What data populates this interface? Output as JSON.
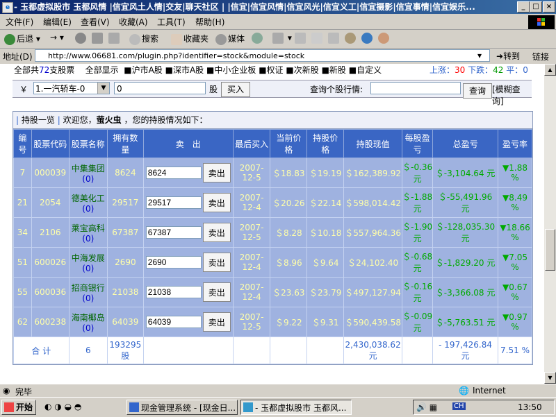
{
  "window": {
    "title": "- 玉都虚拟股市 玉都风情 |信宜风土人情|交友|聊天社区 | |信宜|信宜风情|信宜风光|信宜义工|信宜摄影|信宜事情|信宜娱乐...",
    "min": "_",
    "max": "□",
    "close": "×"
  },
  "menu": [
    "文件(F)",
    "编辑(E)",
    "查看(V)",
    "收藏(A)",
    "工具(T)",
    "帮助(H)"
  ],
  "toolbar": {
    "back": "后退",
    "forward": "→",
    "search": "搜索",
    "favorites": "收藏夹",
    "media": "媒体"
  },
  "address": {
    "label": "地址(D)",
    "url": "http://www.06681.com/plugin.php?identifier=stock&module=stock",
    "go": "转到",
    "links": "链接"
  },
  "summary": {
    "prefix": "全部共",
    "count": "72",
    "suffix": "支股票",
    "show_all": "全部显示",
    "filters": [
      "沪市A股",
      "深市A股",
      "中小企业板",
      "权证",
      "次新股",
      "新股",
      "自定义"
    ],
    "up_label": "上涨：",
    "up": "30",
    "down_label": "下跌：",
    "down": "42",
    "flat_label": "平：",
    "flat": "0"
  },
  "trade": {
    "currency_symbol": "￥",
    "selected_stock": "1.一汽轿车-0",
    "qty": "0",
    "unit": "股",
    "buy": "买入",
    "query_label": "查询个股行情:",
    "query_value": "",
    "query": "查询",
    "fuzzy": "[模糊查询]"
  },
  "panel": {
    "title": "持股一览",
    "welcome": "欢迎您，",
    "user": "萤火虫",
    "info": "，您的持股情况如下："
  },
  "table": {
    "headers": [
      "编号",
      "股票代码",
      "股票名称",
      "拥有数量",
      "卖　出",
      "最后买入",
      "当前价格",
      "持股价格",
      "持股现值",
      "每股盈亏",
      "总盈亏",
      "盈亏率"
    ],
    "sell_button": "卖出",
    "rows": [
      {
        "id": "7",
        "code": "000039",
        "name": "中集集团",
        "cnt": "(0)",
        "qty": "8624",
        "sell_qty": "8624",
        "date": "2007-12-5",
        "price": "＄18.83",
        "hold_price": "＄19.19",
        "value": "＄162,389.92",
        "per": "＄-0.36 元",
        "total": "＄-3,104.64 元",
        "rate": "▼1.88 %"
      },
      {
        "id": "21",
        "code": "2054",
        "name": "德美化工",
        "cnt": "(0)",
        "qty": "29517",
        "sell_qty": "29517",
        "date": "2007-12-4",
        "price": "＄20.26",
        "hold_price": "＄22.14",
        "value": "＄598,014.42",
        "per": "＄-1.88 元",
        "total": "＄-55,491.96 元",
        "rate": "▼8.49 %"
      },
      {
        "id": "34",
        "code": "2106",
        "name": "莱宝高科",
        "cnt": "(0)",
        "qty": "67387",
        "sell_qty": "67387",
        "date": "2007-12-5",
        "price": "＄8.28",
        "hold_price": "＄10.18",
        "value": "＄557,964.36",
        "per": "＄-1.90 元",
        "total": "＄-128,035.30 元",
        "rate": "▼18.66 %"
      },
      {
        "id": "51",
        "code": "600026",
        "name": "中海发展",
        "cnt": "(0)",
        "qty": "2690",
        "sell_qty": "2690",
        "date": "2007-12-4",
        "price": "＄8.96",
        "hold_price": "＄9.64",
        "value": "＄24,102.40",
        "per": "＄-0.68 元",
        "total": "＄-1,829.20 元",
        "rate": "▼7.05 %"
      },
      {
        "id": "55",
        "code": "600036",
        "name": "招商银行",
        "cnt": "(0)",
        "qty": "21038",
        "sell_qty": "21038",
        "date": "2007-12-4",
        "price": "＄23.63",
        "hold_price": "＄23.79",
        "value": "＄497,127.94",
        "per": "＄-0.16 元",
        "total": "＄-3,366.08 元",
        "rate": "▼0.67 %"
      },
      {
        "id": "62",
        "code": "600238",
        "name": "海南椰岛",
        "cnt": "(0)",
        "qty": "64039",
        "sell_qty": "64039",
        "date": "2007-12-5",
        "price": "＄9.22",
        "hold_price": "＄9.31",
        "value": "＄590,439.58",
        "per": "＄-0.09 元",
        "total": "＄-5,763.51 元",
        "rate": "▼0.97 %"
      }
    ],
    "total": {
      "label": "合 计",
      "count": "6",
      "qty": "193295",
      "qty_unit": "股",
      "value": "2,430,038.62",
      "value_unit": "元",
      "total": "- 197,426.84",
      "total_unit": "元",
      "rate": "7.51 %"
    }
  },
  "status": {
    "left": "完毕",
    "zone": "Internet"
  },
  "taskbar": {
    "start": "开始",
    "tasks": [
      "现金管理系统 - [现金日...",
      "- 玉都虚拟股市 玉都风..."
    ],
    "ime": "CH",
    "time": "13:50"
  },
  "colors": {
    "header": "#3a66c4",
    "row": "#9fb2e0",
    "loss": "#00aa00",
    "up": "#ff0000",
    "down": "#009900"
  }
}
